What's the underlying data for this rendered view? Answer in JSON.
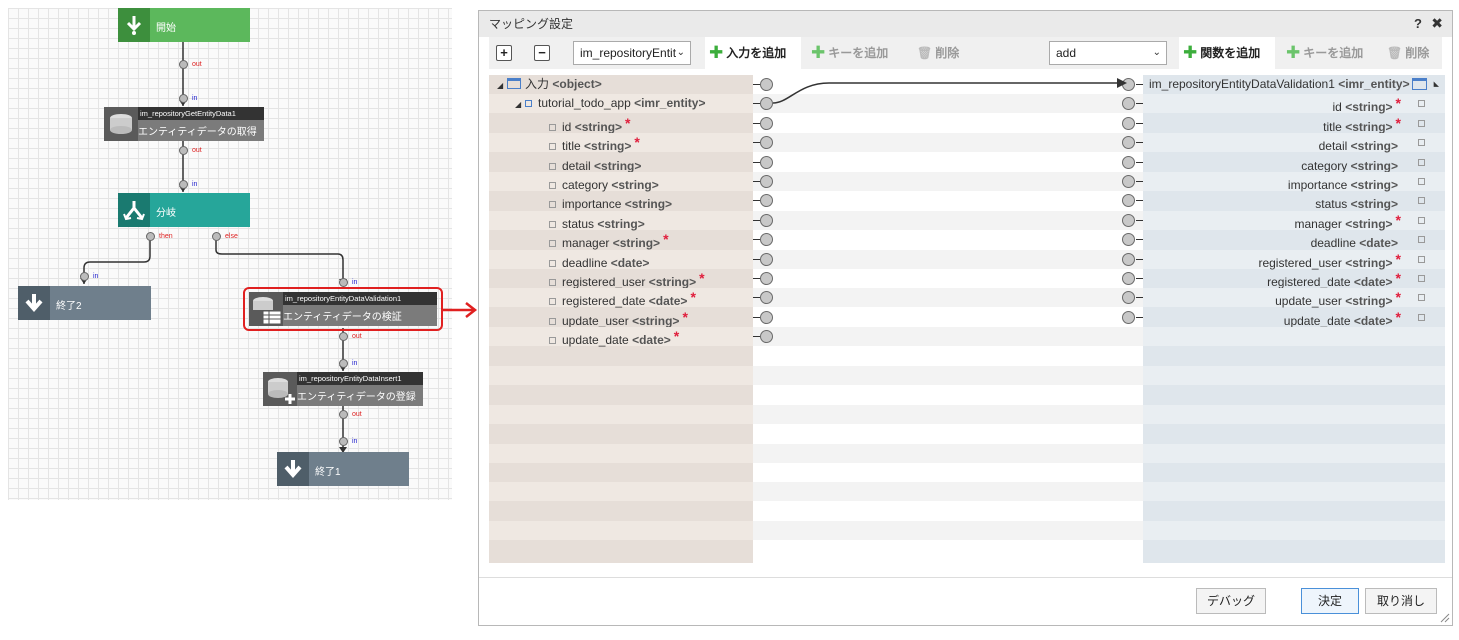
{
  "flow": {
    "start_label": "開始",
    "branch_label": "分岐",
    "end2_label": "終了2",
    "end1_label": "終了1",
    "tasks": [
      {
        "name": "im_repositoryGetEntityData1",
        "label": "エンティティデータの取得"
      },
      {
        "name": "im_repositoryEntityDataValidation1",
        "label": "エンティティデータの検証"
      },
      {
        "name": "im_repositoryEntityDataInsert1",
        "label": "エンティティデータの登録"
      }
    ],
    "ports": {
      "out": "out",
      "in": "in",
      "then": "then",
      "else": "else"
    }
  },
  "dialog": {
    "title": "マッピング設定",
    "help": "?",
    "close": "✖",
    "toolbar": {
      "expand": "+",
      "collapse": "−",
      "left_select": "im_repositoryEntit",
      "add_input": "入力を追加",
      "add_key_left": "キーを追加",
      "delete_left": "削除",
      "right_select": "add",
      "add_function": "関数を追加",
      "add_key_right": "キーを追加",
      "delete_right": "削除"
    },
    "left_tree": {
      "root": {
        "name": "入力",
        "type": "<object>"
      },
      "entity": {
        "name": "tutorial_todo_app",
        "type": "<imr_entity>"
      },
      "fields": [
        {
          "name": "id",
          "type": "<string>",
          "required": "*"
        },
        {
          "name": "title",
          "type": "<string>",
          "required": "*"
        },
        {
          "name": "detail",
          "type": "<string>",
          "required": ""
        },
        {
          "name": "category",
          "type": "<string>",
          "required": ""
        },
        {
          "name": "importance",
          "type": "<string>",
          "required": ""
        },
        {
          "name": "status",
          "type": "<string>",
          "required": ""
        },
        {
          "name": "manager",
          "type": "<string>",
          "required": "*"
        },
        {
          "name": "deadline",
          "type": "<date>",
          "required": ""
        },
        {
          "name": "registered_user",
          "type": "<string>",
          "required": "*"
        },
        {
          "name": "registered_date",
          "type": "<date>",
          "required": "*"
        },
        {
          "name": "update_user",
          "type": "<string>",
          "required": "*"
        },
        {
          "name": "update_date",
          "type": "<date>",
          "required": "*"
        }
      ]
    },
    "right_tree": {
      "root": {
        "name": "im_repositoryEntityDataValidation1",
        "type": "<imr_entity>"
      },
      "fields": [
        {
          "name": "id",
          "type": "<string>",
          "required": "*"
        },
        {
          "name": "title",
          "type": "<string>",
          "required": "*"
        },
        {
          "name": "detail",
          "type": "<string>",
          "required": ""
        },
        {
          "name": "category",
          "type": "<string>",
          "required": ""
        },
        {
          "name": "importance",
          "type": "<string>",
          "required": ""
        },
        {
          "name": "status",
          "type": "<string>",
          "required": ""
        },
        {
          "name": "manager",
          "type": "<string>",
          "required": "*"
        },
        {
          "name": "deadline",
          "type": "<date>",
          "required": ""
        },
        {
          "name": "registered_user",
          "type": "<string>",
          "required": "*"
        },
        {
          "name": "registered_date",
          "type": "<date>",
          "required": "*"
        },
        {
          "name": "update_user",
          "type": "<string>",
          "required": "*"
        },
        {
          "name": "update_date",
          "type": "<date>",
          "required": "*"
        }
      ]
    },
    "footer": {
      "debug": "デバッグ",
      "ok": "決定",
      "cancel": "取り消し"
    }
  },
  "colors": {
    "start": "#5cb85c",
    "branch": "#26a69a",
    "end": "#6f7f8c",
    "task": "#7b7b7b",
    "selection": "#e02020",
    "required": "#e01e3c",
    "add_green": "#3cae3c"
  }
}
